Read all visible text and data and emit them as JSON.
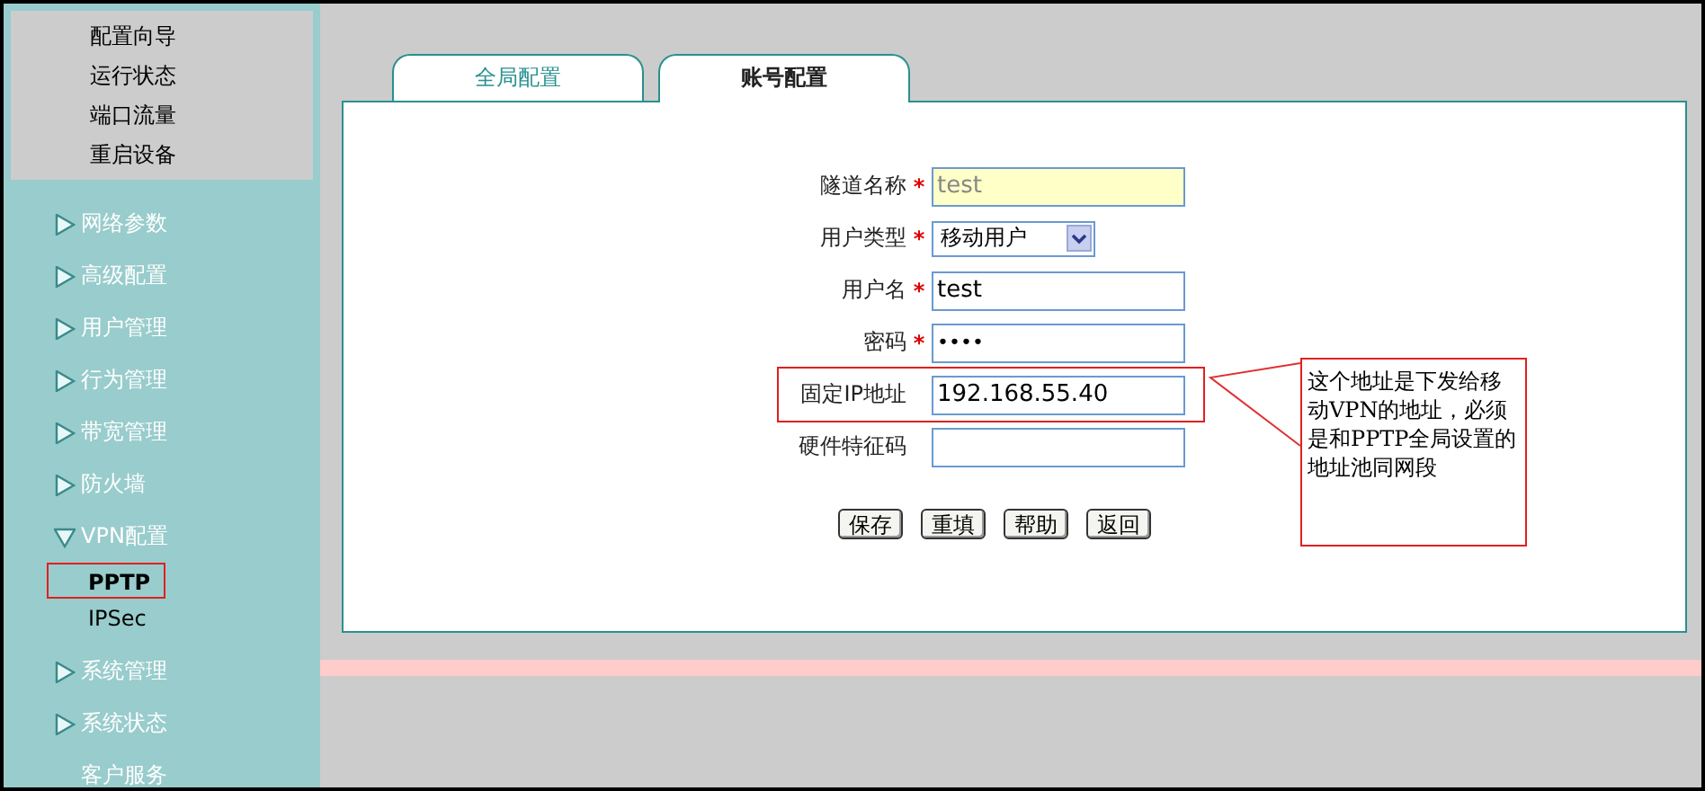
{
  "quick_links": [
    {
      "label": "配置向导"
    },
    {
      "label": "运行状态"
    },
    {
      "label": "端口流量"
    },
    {
      "label": "重启设备"
    }
  ],
  "menu": [
    {
      "label": "网络参数",
      "expandable": true,
      "expanded": false
    },
    {
      "label": "高级配置",
      "expandable": true,
      "expanded": false
    },
    {
      "label": "用户管理",
      "expandable": true,
      "expanded": false
    },
    {
      "label": "行为管理",
      "expandable": true,
      "expanded": false
    },
    {
      "label": "带宽管理",
      "expandable": true,
      "expanded": false
    },
    {
      "label": "防火墙",
      "expandable": true,
      "expanded": false
    },
    {
      "label": "VPN配置",
      "expandable": true,
      "expanded": true,
      "children": [
        {
          "label": "PPTP",
          "selected": true
        },
        {
          "label": "IPSec",
          "selected": false
        }
      ]
    },
    {
      "label": "系统管理",
      "expandable": true,
      "expanded": false
    },
    {
      "label": "系统状态",
      "expandable": true,
      "expanded": false
    },
    {
      "label": "客户服务",
      "expandable": false
    }
  ],
  "tabs": [
    {
      "label": "全局配置",
      "selected": false
    },
    {
      "label": "账号配置",
      "selected": true
    }
  ],
  "form": {
    "fields": [
      {
        "label": "隧道名称",
        "kind": "text",
        "required": true,
        "disabled": true,
        "highlighted": false,
        "value": "test"
      },
      {
        "label": "用户类型",
        "kind": "select",
        "required": true,
        "disabled": false,
        "highlighted": false,
        "value": "移动用户"
      },
      {
        "label": "用户名",
        "kind": "text",
        "required": true,
        "disabled": false,
        "highlighted": false,
        "value": "test"
      },
      {
        "label": "密码",
        "kind": "password",
        "required": true,
        "disabled": false,
        "highlighted": false,
        "value": "••••"
      },
      {
        "label": "固定IP地址",
        "kind": "text",
        "required": false,
        "disabled": false,
        "highlighted": true,
        "value": "192.168.55.40"
      },
      {
        "label": "硬件特征码",
        "kind": "text",
        "required": false,
        "disabled": false,
        "highlighted": false
      }
    ],
    "required_mark": "*",
    "buttons": [
      "保存",
      "重填",
      "帮助",
      "返回"
    ]
  },
  "annotation": {
    "text": "这个地址是下发给移动VPN的地址，必须是和PPTP全局设置的地址池同网段"
  }
}
